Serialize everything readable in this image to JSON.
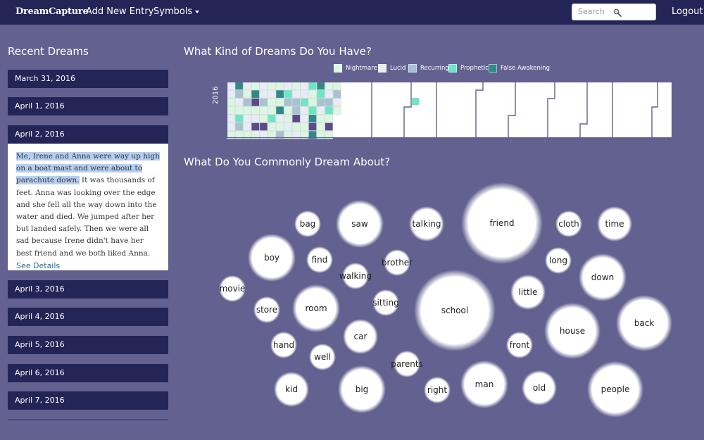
{
  "navbar": {
    "brand": "DreamCapture",
    "add_entry": "Add New Entry",
    "symbols": "Symbols",
    "search_placeholder": "Search",
    "logout": "Logout"
  },
  "sidebar": {
    "title": "Recent Dreams",
    "dates": [
      "March 31, 2016",
      "April 1, 2016",
      "April 2, 2016",
      "April 3, 2016",
      "April 4, 2016",
      "April 5, 2016",
      "April 6, 2016",
      "April 7, 2016"
    ],
    "entry": {
      "highlighted": "Me, Irene and Anna were way up high on a boat mast and were about to parachute down.",
      "rest": " It was thousands of feet. Anna was looking over the edge and she fell all the way down into the water and died. We jumped after her but landed safely. Then we were all sad because Irene didn't have her best friend and we both liked Anna.",
      "link": "See Details"
    }
  },
  "calendar": {
    "title": "What Kind of Dreams Do You Have?",
    "year": "2016",
    "legend": [
      {
        "label": "Nightmare",
        "color": "#dbf7e0"
      },
      {
        "label": "Lucid",
        "color": "#e8ecf4"
      },
      {
        "label": "Recurring",
        "color": "#a9c2cf"
      },
      {
        "label": "Prophetic",
        "color": "#6ee6c4"
      },
      {
        "label": "False Awakening",
        "color": "#2f8a86"
      }
    ],
    "colors": {
      "nightmare": "#dbf7e0",
      "lucid": "#e8ecf4",
      "recurring": "#a9c2cf",
      "prophetic": "#6ee6c4",
      "false_awakening": "#2f8a86",
      "empty": "#ffffff",
      "purple": "#5c4a86"
    }
  },
  "bubbles": {
    "title": "What Do You Commonly Dream About?",
    "words": [
      {
        "word": "bag",
        "size": 1
      },
      {
        "word": "saw",
        "size": 3
      },
      {
        "word": "talking",
        "size": 2
      },
      {
        "word": "friend",
        "size": 6
      },
      {
        "word": "cloth",
        "size": 1
      },
      {
        "word": "time",
        "size": 2
      },
      {
        "word": "boy",
        "size": 3
      },
      {
        "word": "find",
        "size": 1
      },
      {
        "word": "brother",
        "size": 1
      },
      {
        "word": "long",
        "size": 1
      },
      {
        "word": "walking",
        "size": 1
      },
      {
        "word": "down",
        "size": 3
      },
      {
        "word": "movie",
        "size": 1
      },
      {
        "word": "room",
        "size": 3
      },
      {
        "word": "sitting",
        "size": 1
      },
      {
        "word": "little",
        "size": 2
      },
      {
        "word": "store",
        "size": 1
      },
      {
        "word": "school",
        "size": 6
      },
      {
        "word": "back",
        "size": 4
      },
      {
        "word": "house",
        "size": 4
      },
      {
        "word": "car",
        "size": 2
      },
      {
        "word": "hand",
        "size": 1
      },
      {
        "word": "front",
        "size": 1
      },
      {
        "word": "well",
        "size": 1
      },
      {
        "word": "parents",
        "size": 1
      },
      {
        "word": "kid",
        "size": 2
      },
      {
        "word": "big",
        "size": 3
      },
      {
        "word": "right",
        "size": 1
      },
      {
        "word": "man",
        "size": 3
      },
      {
        "word": "old",
        "size": 2
      },
      {
        "word": "people",
        "size": 4
      }
    ]
  }
}
